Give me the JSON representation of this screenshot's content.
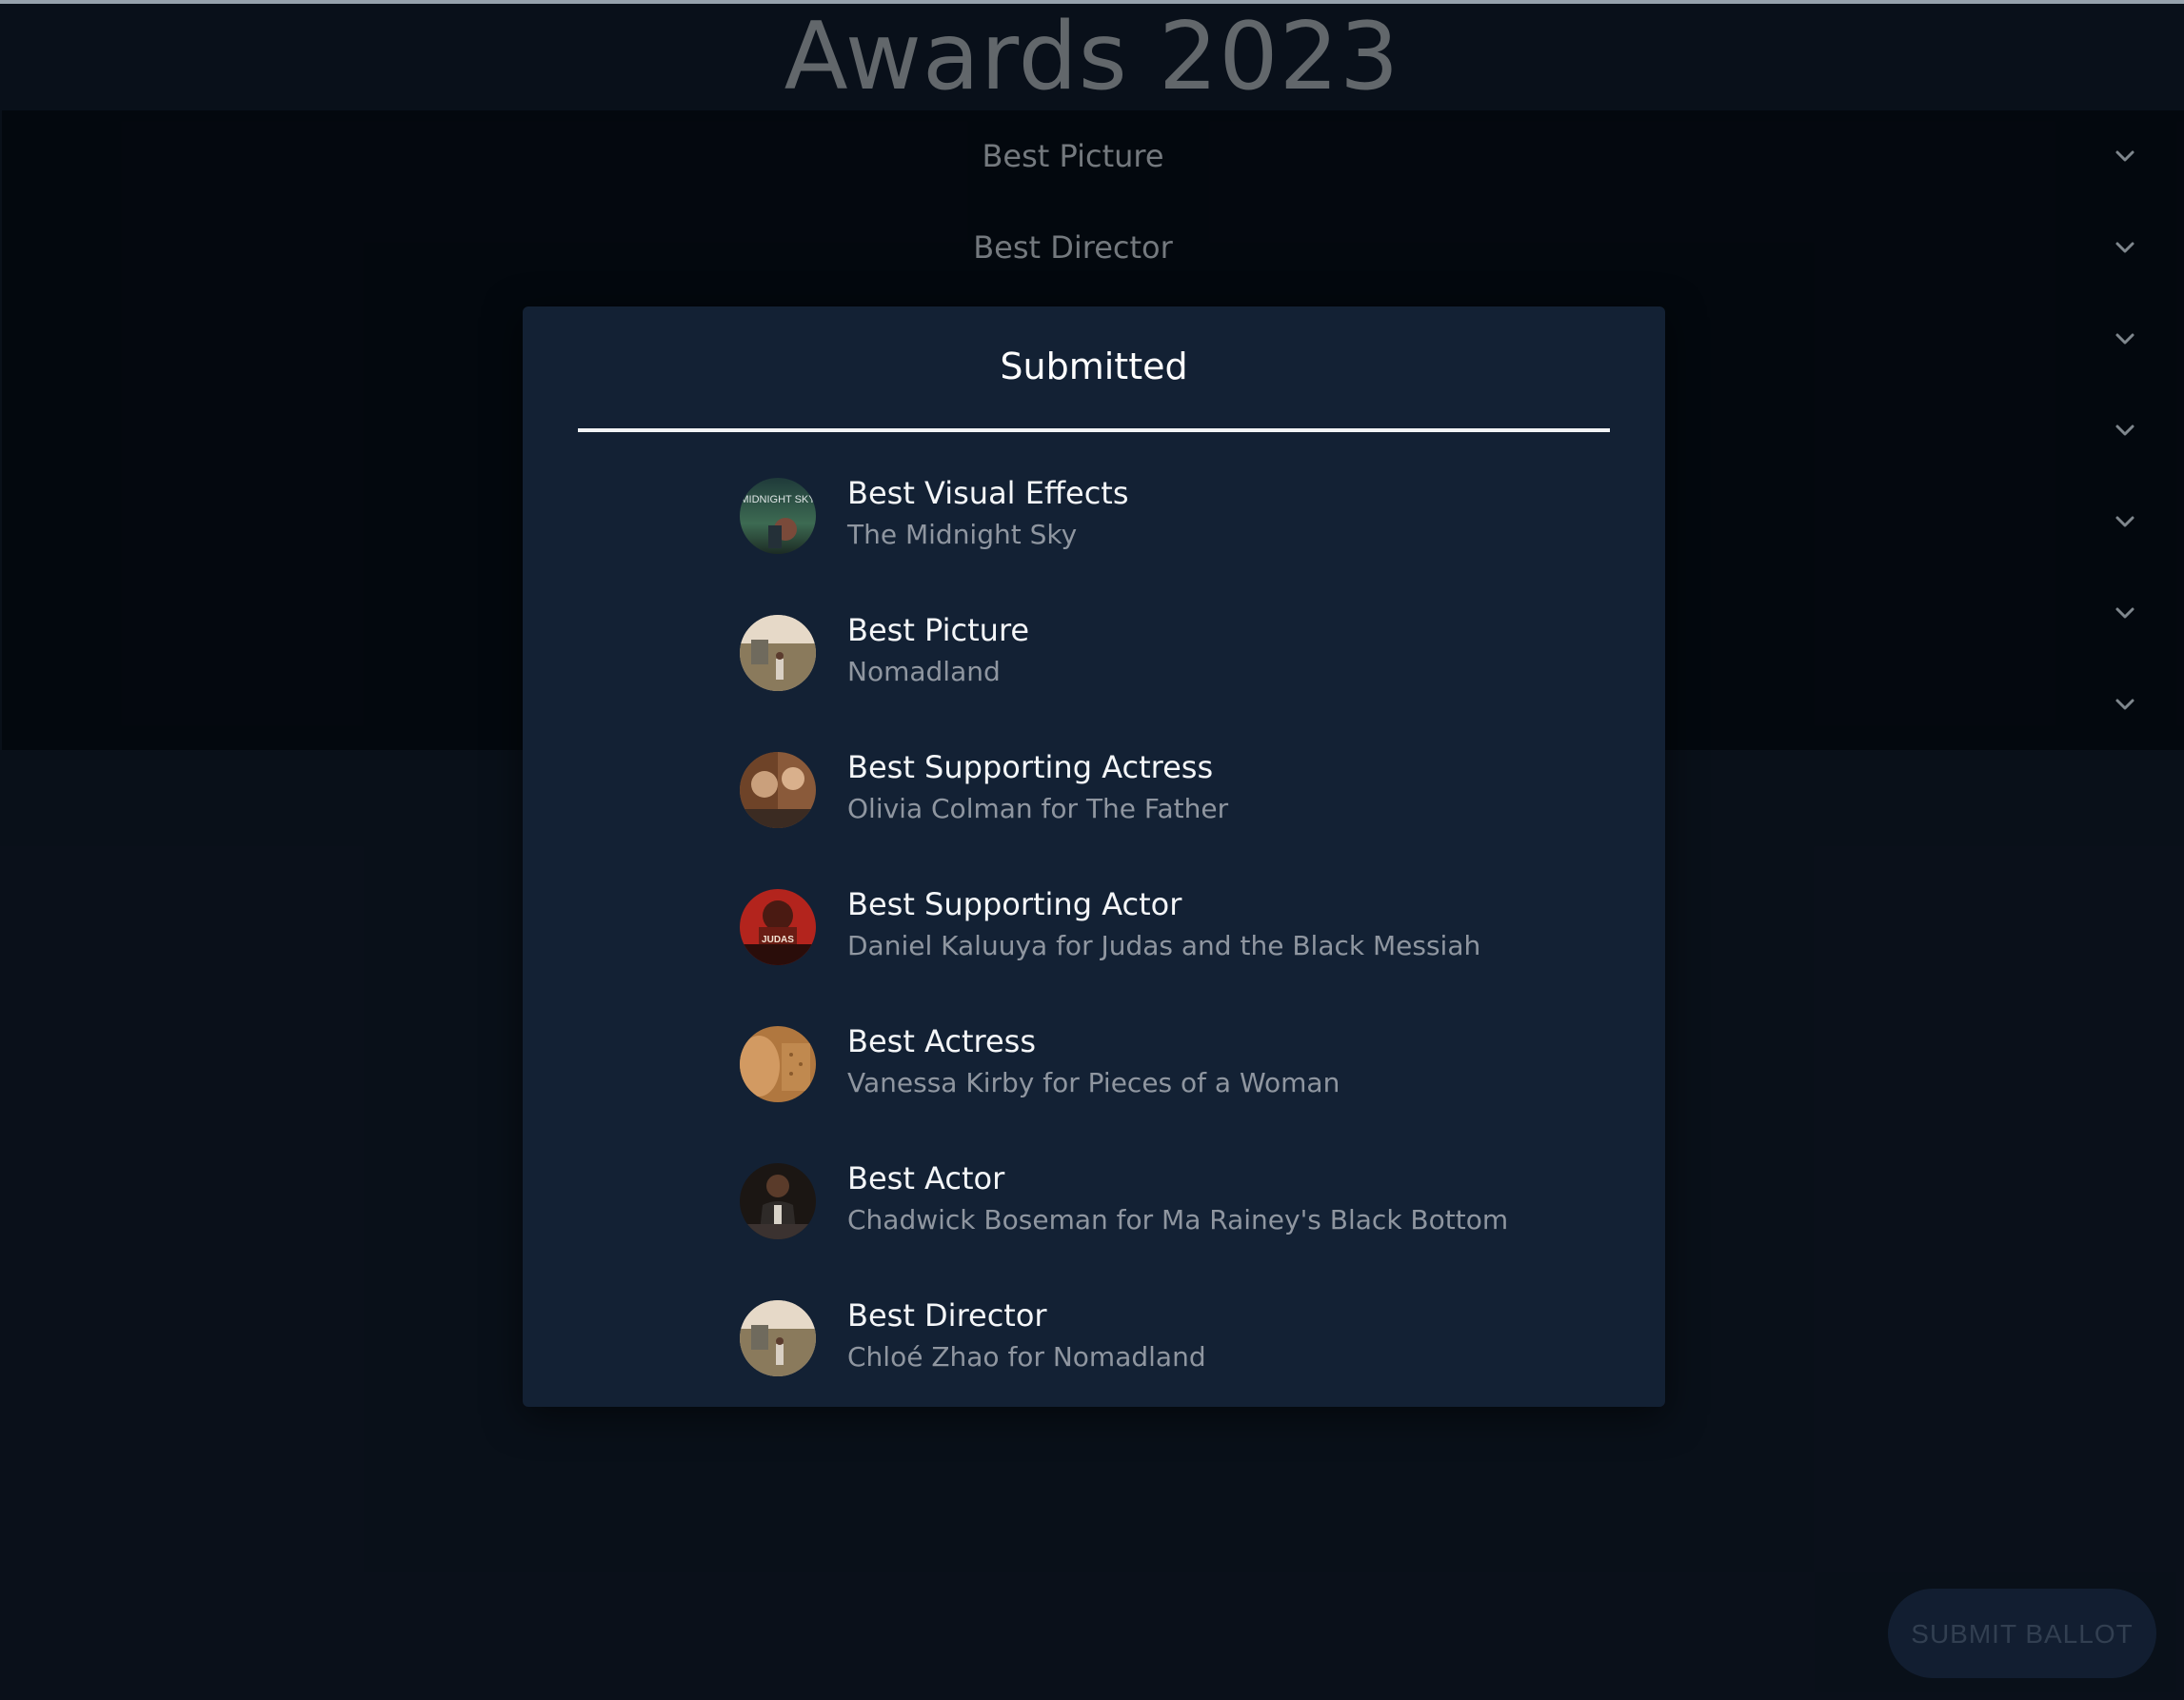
{
  "app": {
    "title": "Awards 2023"
  },
  "categories": [
    {
      "label": "Best Picture"
    },
    {
      "label": "Best Director"
    },
    {
      "label": ""
    },
    {
      "label": ""
    },
    {
      "label": ""
    },
    {
      "label": ""
    },
    {
      "label": ""
    }
  ],
  "modal": {
    "title": "Submitted",
    "items": [
      {
        "category": "Best Visual Effects",
        "pick": "The Midnight Sky",
        "poster_text": "MIDNIGHT SKY"
      },
      {
        "category": "Best Picture",
        "pick": "Nomadland"
      },
      {
        "category": "Best Supporting Actress",
        "pick": "Olivia Colman for The Father"
      },
      {
        "category": "Best Supporting Actor",
        "pick": "Daniel Kaluuya for Judas and the Black Messiah",
        "poster_text": "JUDAS"
      },
      {
        "category": "Best Actress",
        "pick": "Vanessa Kirby for Pieces of a Woman"
      },
      {
        "category": "Best Actor",
        "pick": "Chadwick Boseman for Ma Rainey's Black Bottom"
      },
      {
        "category": "Best Director",
        "pick": "Chloé Zhao for Nomadland"
      }
    ]
  },
  "footer": {
    "submit_label": "SUBMIT BALLOT"
  },
  "icons": {
    "expand": "chevron-down-icon"
  },
  "colors": {
    "background": "#0a101a",
    "modal_background": "#132134",
    "button_background": "#152238"
  }
}
